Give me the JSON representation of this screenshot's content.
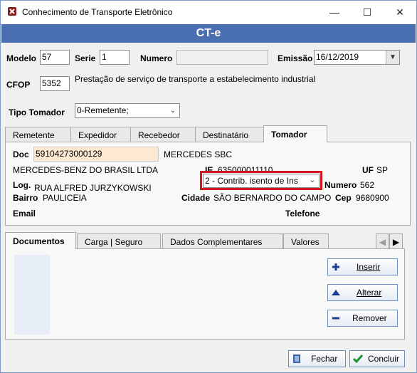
{
  "window": {
    "title": "Conhecimento de Transporte Eletrônico",
    "minimize": "—",
    "maximize": "☐",
    "close": "✕"
  },
  "header": {
    "banner": "CT-e"
  },
  "form": {
    "modelo_label": "Modelo",
    "modelo_value": "57",
    "serie_label": "Serie",
    "serie_value": "1",
    "numero_label": "Numero",
    "numero_value": "",
    "emissao_label": "Emissão",
    "emissao_value": "16/12/2019",
    "cfop_label": "CFOP",
    "cfop_value": "5352",
    "cfop_desc": "Prestação de serviço de transporte a estabelecimento industrial",
    "tipo_tomador_label": "Tipo Tomador",
    "tipo_tomador_value": "0-Remetente;"
  },
  "tabs": [
    "Remetente",
    "Expedidor",
    "Recebedor",
    "Destinatário",
    "Tomador"
  ],
  "tomador": {
    "doc_label": "Doc",
    "doc_value": "59104273000129",
    "doc_name": "MERCEDES SBC",
    "razao": "MERCEDES-BENZ DO BRASIL LTDA",
    "ie_label": "IE.",
    "ie_value": "635000011110",
    "uf_label": "UF",
    "uf_value": "SP",
    "log_label": "Log.",
    "log_value": "RUA ALFRED JURZYKOWSKI",
    "contrib_value": "2 - Contrib. isento de Ins",
    "numero_label": "Numero",
    "numero_value": "562",
    "bairro_label": "Bairro",
    "bairro_value": "PAULICEIA",
    "cidade_label": "Cidade",
    "cidade_value": "SÃO BERNARDO DO CAMPO",
    "cep_label": "Cep",
    "cep_value": "9680900",
    "email_label": "Email",
    "telefone_label": "Telefone"
  },
  "doc_tabs": [
    "Documentos",
    "Carga | Seguro",
    "Dados Complementares",
    "Valores"
  ],
  "doc_actions": {
    "inserir": "Inserir",
    "alterar": "Alterar",
    "remover": "Remover"
  },
  "footer": {
    "fechar": "Fechar",
    "concluir": "Concluir"
  },
  "colors": {
    "banner": "#4a6fb0",
    "highlight": "#d11820",
    "doc_field": "#fde9d3"
  }
}
